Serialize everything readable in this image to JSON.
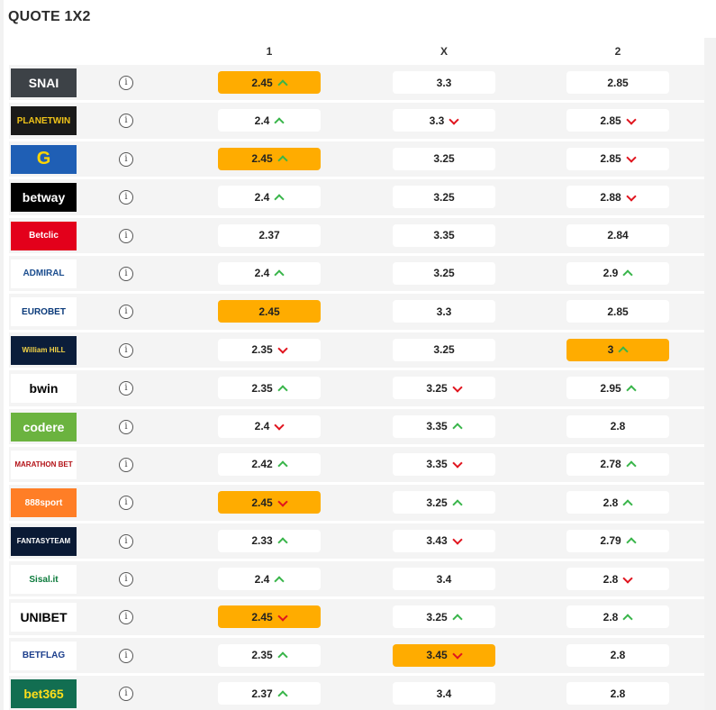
{
  "title": "QUOTE 1X2",
  "columns": [
    "1",
    "X",
    "2"
  ],
  "info_glyph": "i",
  "colors": {
    "best": "#ffac00",
    "up": "#39b54a",
    "down": "#e0141e"
  },
  "rows": [
    {
      "bookmaker": "SNAI",
      "logo_bg": "#3d4247",
      "logo_fg": "#ffffff",
      "odds": [
        {
          "value": "2.45",
          "trend": "up",
          "best": true
        },
        {
          "value": "3.3",
          "trend": "",
          "best": false
        },
        {
          "value": "2.85",
          "trend": "",
          "best": false
        }
      ]
    },
    {
      "bookmaker": "PLANETWIN",
      "logo_bg": "#1a1a1a",
      "logo_fg": "#f0c419",
      "odds": [
        {
          "value": "2.4",
          "trend": "up",
          "best": false
        },
        {
          "value": "3.3",
          "trend": "down",
          "best": false
        },
        {
          "value": "2.85",
          "trend": "down",
          "best": false
        }
      ]
    },
    {
      "bookmaker": "G",
      "logo_bg": "#1f5fb5",
      "logo_fg": "#ffd500",
      "odds": [
        {
          "value": "2.45",
          "trend": "up",
          "best": true
        },
        {
          "value": "3.25",
          "trend": "",
          "best": false
        },
        {
          "value": "2.85",
          "trend": "down",
          "best": false
        }
      ]
    },
    {
      "bookmaker": "betway",
      "logo_bg": "#000000",
      "logo_fg": "#ffffff",
      "odds": [
        {
          "value": "2.4",
          "trend": "up",
          "best": false
        },
        {
          "value": "3.25",
          "trend": "",
          "best": false
        },
        {
          "value": "2.88",
          "trend": "down",
          "best": false
        }
      ]
    },
    {
      "bookmaker": "Betclic",
      "logo_bg": "#e3001b",
      "logo_fg": "#ffffff",
      "odds": [
        {
          "value": "2.37",
          "trend": "",
          "best": false
        },
        {
          "value": "3.35",
          "trend": "",
          "best": false
        },
        {
          "value": "2.84",
          "trend": "",
          "best": false
        }
      ]
    },
    {
      "bookmaker": "ADMIRAL",
      "logo_bg": "#ffffff",
      "logo_fg": "#1c4e8f",
      "odds": [
        {
          "value": "2.4",
          "trend": "up",
          "best": false
        },
        {
          "value": "3.25",
          "trend": "",
          "best": false
        },
        {
          "value": "2.9",
          "trend": "up",
          "best": false
        }
      ]
    },
    {
      "bookmaker": "EUROBET",
      "logo_bg": "#ffffff",
      "logo_fg": "#0a3a7a",
      "odds": [
        {
          "value": "2.45",
          "trend": "",
          "best": true
        },
        {
          "value": "3.3",
          "trend": "",
          "best": false
        },
        {
          "value": "2.85",
          "trend": "",
          "best": false
        }
      ]
    },
    {
      "bookmaker": "William HILL",
      "logo_bg": "#0b1d3a",
      "logo_fg": "#f5d547",
      "odds": [
        {
          "value": "2.35",
          "trend": "down",
          "best": false
        },
        {
          "value": "3.25",
          "trend": "",
          "best": false
        },
        {
          "value": "3",
          "trend": "up",
          "best": true
        }
      ]
    },
    {
      "bookmaker": "bwin",
      "logo_bg": "#ffffff",
      "logo_fg": "#000000",
      "odds": [
        {
          "value": "2.35",
          "trend": "up",
          "best": false
        },
        {
          "value": "3.25",
          "trend": "down",
          "best": false
        },
        {
          "value": "2.95",
          "trend": "up",
          "best": false
        }
      ]
    },
    {
      "bookmaker": "codere",
      "logo_bg": "#6bb33f",
      "logo_fg": "#ffffff",
      "odds": [
        {
          "value": "2.4",
          "trend": "down",
          "best": false
        },
        {
          "value": "3.35",
          "trend": "up",
          "best": false
        },
        {
          "value": "2.8",
          "trend": "",
          "best": false
        }
      ]
    },
    {
      "bookmaker": "MARATHON BET",
      "logo_bg": "#ffffff",
      "logo_fg": "#b31217",
      "odds": [
        {
          "value": "2.42",
          "trend": "up",
          "best": false
        },
        {
          "value": "3.35",
          "trend": "down",
          "best": false
        },
        {
          "value": "2.78",
          "trend": "up",
          "best": false
        }
      ]
    },
    {
      "bookmaker": "888sport",
      "logo_bg": "#ff7e26",
      "logo_fg": "#ffffff",
      "odds": [
        {
          "value": "2.45",
          "trend": "down",
          "best": true
        },
        {
          "value": "3.25",
          "trend": "up",
          "best": false
        },
        {
          "value": "2.8",
          "trend": "up",
          "best": false
        }
      ]
    },
    {
      "bookmaker": "FANTASYTEAM",
      "logo_bg": "#0a1a35",
      "logo_fg": "#ffffff",
      "odds": [
        {
          "value": "2.33",
          "trend": "up",
          "best": false
        },
        {
          "value": "3.43",
          "trend": "down",
          "best": false
        },
        {
          "value": "2.79",
          "trend": "up",
          "best": false
        }
      ]
    },
    {
      "bookmaker": "Sisal.it",
      "logo_bg": "#ffffff",
      "logo_fg": "#0b7a3b",
      "odds": [
        {
          "value": "2.4",
          "trend": "up",
          "best": false
        },
        {
          "value": "3.4",
          "trend": "",
          "best": false
        },
        {
          "value": "2.8",
          "trend": "down",
          "best": false
        }
      ]
    },
    {
      "bookmaker": "UNIBET",
      "logo_bg": "#ffffff",
      "logo_fg": "#000000",
      "odds": [
        {
          "value": "2.45",
          "trend": "down",
          "best": true
        },
        {
          "value": "3.25",
          "trend": "up",
          "best": false
        },
        {
          "value": "2.8",
          "trend": "up",
          "best": false
        }
      ]
    },
    {
      "bookmaker": "BETFLAG",
      "logo_bg": "#ffffff",
      "logo_fg": "#1b3e8c",
      "odds": [
        {
          "value": "2.35",
          "trend": "up",
          "best": false
        },
        {
          "value": "3.45",
          "trend": "down",
          "best": true
        },
        {
          "value": "2.8",
          "trend": "",
          "best": false
        }
      ]
    },
    {
      "bookmaker": "bet365",
      "logo_bg": "#126e51",
      "logo_fg": "#ffdf1b",
      "odds": [
        {
          "value": "2.37",
          "trend": "up",
          "best": false
        },
        {
          "value": "3.4",
          "trend": "",
          "best": false
        },
        {
          "value": "2.8",
          "trend": "",
          "best": false
        }
      ]
    }
  ]
}
